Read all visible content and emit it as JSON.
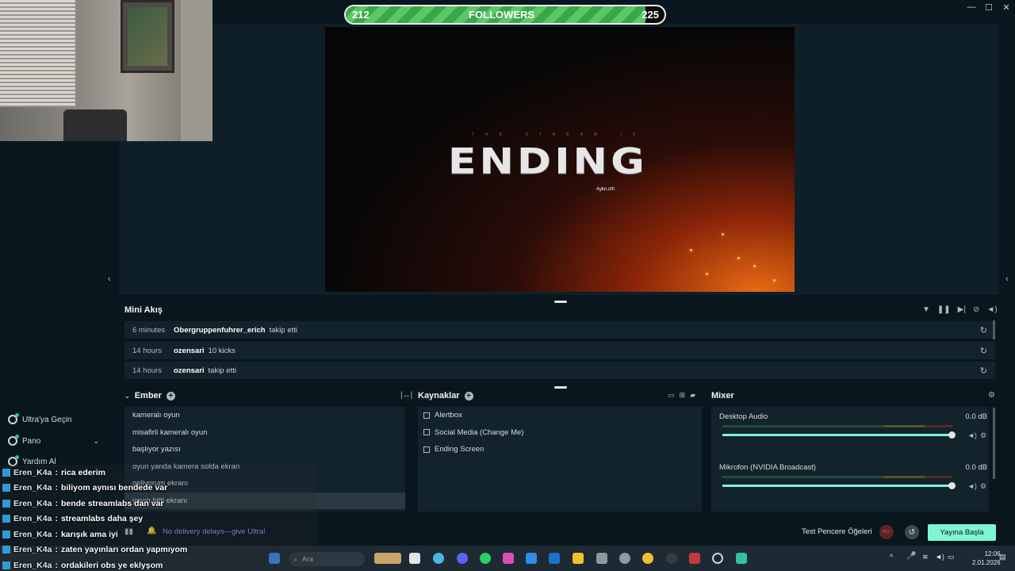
{
  "window": {
    "minimize": "—",
    "maximize": "☐",
    "close": "✕"
  },
  "followers": {
    "current": "212",
    "label": "FOLLOWERS",
    "goal": "225",
    "progress": 0.94
  },
  "canvas": {
    "subtitle": "THE STREAM IS",
    "title": "ENDING",
    "handle": "Aykn.cth"
  },
  "sidebar": {
    "items": [
      {
        "label": "Ultra'ya Geçin"
      },
      {
        "label": "Pano"
      },
      {
        "label": "Yardım Al"
      }
    ]
  },
  "chat": [
    {
      "user": "Eren_K4a",
      "msg": "rica ederim"
    },
    {
      "user": "Eren_K4a",
      "msg": "biliyom aynısı bendede var"
    },
    {
      "user": "Eren_K4a",
      "msg": "bende streamlabs dan var"
    },
    {
      "user": "Eren_K4a",
      "msg": "streamlabs daha şey"
    },
    {
      "user": "Eren_K4a",
      "msg": "karışık ama iyi"
    },
    {
      "user": "Eren_K4a",
      "msg": "zaten yayınları ordan yapmıyom"
    },
    {
      "user": "Eren_K4a",
      "msg": "ordakileri obs ye eklyşom"
    }
  ],
  "minifeed": {
    "title": "Mini Akış",
    "rows": [
      {
        "time": "6 minutes",
        "name": "Obergruppenfuhrer_erich",
        "action": "takip etti"
      },
      {
        "time": "14 hours",
        "name": "ozensari",
        "action": "10 kicks"
      },
      {
        "time": "14 hours",
        "name": "ozensari",
        "action": "takip etti"
      }
    ]
  },
  "scenes": {
    "title": "Ember",
    "items": [
      "kameralı oyun",
      "misafirli kameralı oyun",
      "başlıyor yazısı",
      "oyun yanda kamera solda ekran",
      "geliyorum ekranı",
      "yayın bitti ekranı"
    ],
    "selected_index": 5
  },
  "sources": {
    "title": "Kaynaklar",
    "items": [
      "Alertbox",
      "Social Media (Change Me)",
      "Ending Screen"
    ]
  },
  "mixer": {
    "title": "Mixer",
    "channels": [
      {
        "name": "Desktop Audio",
        "db": "0.0 dB",
        "level": 1.0
      },
      {
        "name": "Mikrofon (NVIDIA Broadcast)",
        "db": "0.0 dB",
        "level": 1.0
      }
    ]
  },
  "footer": {
    "ultra_msg": "No delivery delays—give Ultra!",
    "test_widgets": "Test Pencere Öğeleri",
    "rec": "REC",
    "go_live": "Yayına Başla"
  },
  "taskbar": {
    "search_placeholder": "Ara",
    "time": "12:06",
    "date": "2.01.2026"
  },
  "colors": {
    "accent": "#80f5d2",
    "bg": "#09161d",
    "panel": "#13232c",
    "ultra": "#a98df5",
    "followers_fill": "#3aa64a"
  }
}
